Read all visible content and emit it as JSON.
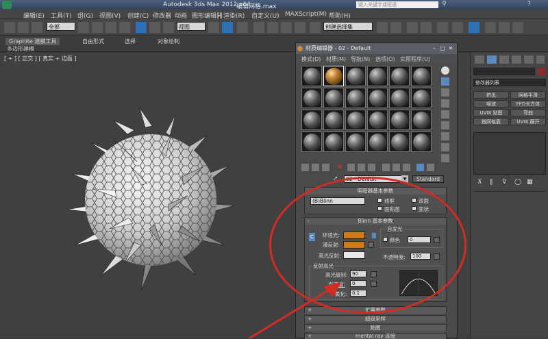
{
  "title": {
    "app": "Autodesk 3ds Max  2012 x64",
    "doc": "编辑网格.max",
    "search_placeholder": "键入关键字或短语"
  },
  "menubar": [
    "编辑(E)",
    "工具(T)",
    "组(G)",
    "视图(V)",
    "创建(C)",
    "修改器",
    "动画",
    "图形编辑器",
    "渲染(R)",
    "自定义(U)",
    "MAXScript(M)",
    "帮助(H)"
  ],
  "toolbar": {
    "selection_filter": "全部",
    "ref_coord": "视图",
    "named_sel": "创建选择集"
  },
  "ribbon": {
    "tabs": [
      "Graphite 建模工具",
      "自由形式",
      "选择",
      "对象绘制"
    ],
    "subtitle": "多边形建模"
  },
  "viewport": {
    "label": "[ + ] [ 正交 ] [ 真实 + 边面 ]"
  },
  "cmdpanel": {
    "modifier_list": "修改器列表",
    "buttons": [
      "挤出",
      "网格平滑",
      "噪波",
      "FFD长方体",
      "UVW 贴图",
      "弯曲",
      "按网格面",
      "UVW 展开"
    ]
  },
  "material_editor": {
    "title": "材质编辑器 - 02 - Default",
    "menu": [
      "模式(D)",
      "材质(M)",
      "导航(N)",
      "选项(O)",
      "实用程序(U)"
    ],
    "material_name": "02 - Default",
    "material_type": "Standard",
    "shader_rollout": {
      "title": "明暗器基本参数",
      "shader": "(B)Blinn",
      "wire": "线框",
      "two_sided": "双面",
      "face_map": "面贴图",
      "faceted": "面状"
    },
    "blinn_rollout": {
      "title": "Blinn 基本参数",
      "ambient": "环境光:",
      "diffuse": "漫反射:",
      "specular": "高光反射:",
      "self_illum": "自发光",
      "color": "颜色",
      "self_illum_value": "0",
      "opacity_label": "不透明度:",
      "opacity": "100",
      "ambient_color": "#d07a1a",
      "diffuse_color": "#d07a1a",
      "specular_color": "#e8e8e8",
      "lock_letter": "C"
    },
    "spec_section": {
      "title": "反射高光",
      "spec_level_label": "高光级别:",
      "spec_level": "90",
      "gloss_label": "光泽度:",
      "gloss": "0",
      "soften_label": "柔化:",
      "soften": "0.1"
    },
    "rollouts": [
      "扩展参数",
      "超级采样",
      "贴图",
      "mental ray 连接"
    ]
  },
  "annotation_color": "#d42b22"
}
